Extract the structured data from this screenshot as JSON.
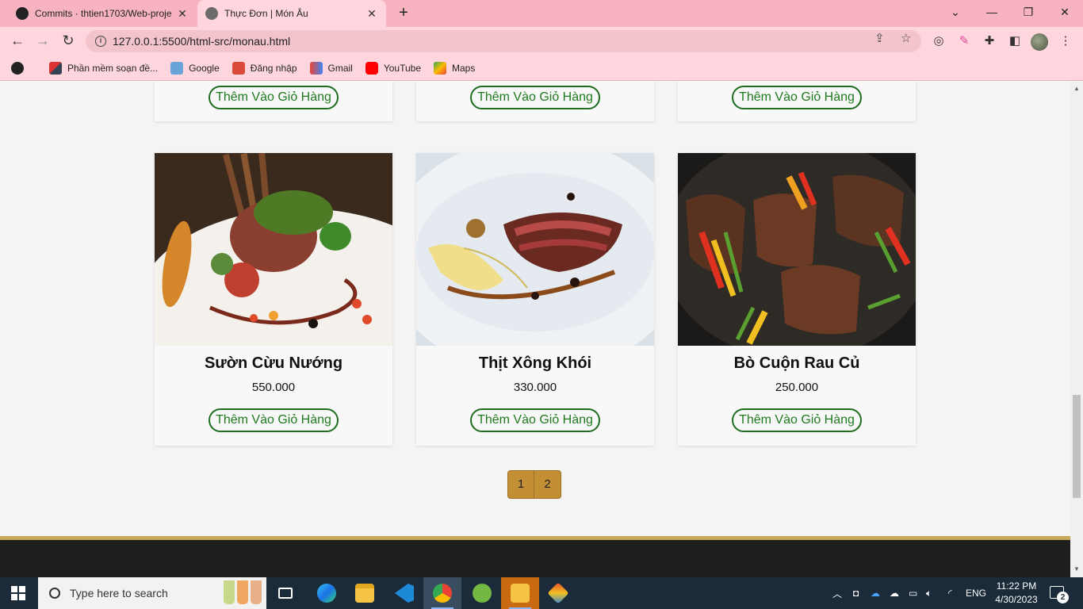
{
  "browser": {
    "tabs": [
      {
        "title": "Commits · thtien1703/Web-proje",
        "active": false,
        "icon": "github-icon"
      },
      {
        "title": "Thực Đơn | Món Âu",
        "active": true,
        "icon": "globe-icon"
      }
    ],
    "address": "127.0.0.1:5500/html-src/monau.html",
    "bookmarks": [
      {
        "label": "Phần mềm soạn đề...",
        "icon": "v-logo-icon"
      },
      {
        "label": "Google",
        "icon": "google-icon"
      },
      {
        "label": "Đăng nhập",
        "icon": "login-icon"
      },
      {
        "label": "Gmail",
        "icon": "gmail-icon"
      },
      {
        "label": "YouTube",
        "icon": "youtube-icon"
      },
      {
        "label": "Maps",
        "icon": "maps-icon"
      }
    ]
  },
  "page": {
    "add_to_cart_label": "Thêm Vào Giỏ Hàng",
    "products": [
      {
        "name": "Sườn Cừu Nướng",
        "price": "550.000",
        "image": "lamb-ribs-dish"
      },
      {
        "name": "Thịt Xông Khói",
        "price": "330.000",
        "image": "smoked-meat-dish"
      },
      {
        "name": "Bò Cuộn Rau Củ",
        "price": "250.000",
        "image": "beef-vegetable-rolls"
      }
    ],
    "pagination": [
      "1",
      "2"
    ],
    "colors": {
      "accent": "#c38f35",
      "button_green": "#1f7a1f",
      "footer": "#1f1f1f"
    }
  },
  "taskbar": {
    "search_placeholder": "Type here to search",
    "language": "ENG",
    "time": "11:22 PM",
    "date": "4/30/2023",
    "notifications": "2"
  }
}
